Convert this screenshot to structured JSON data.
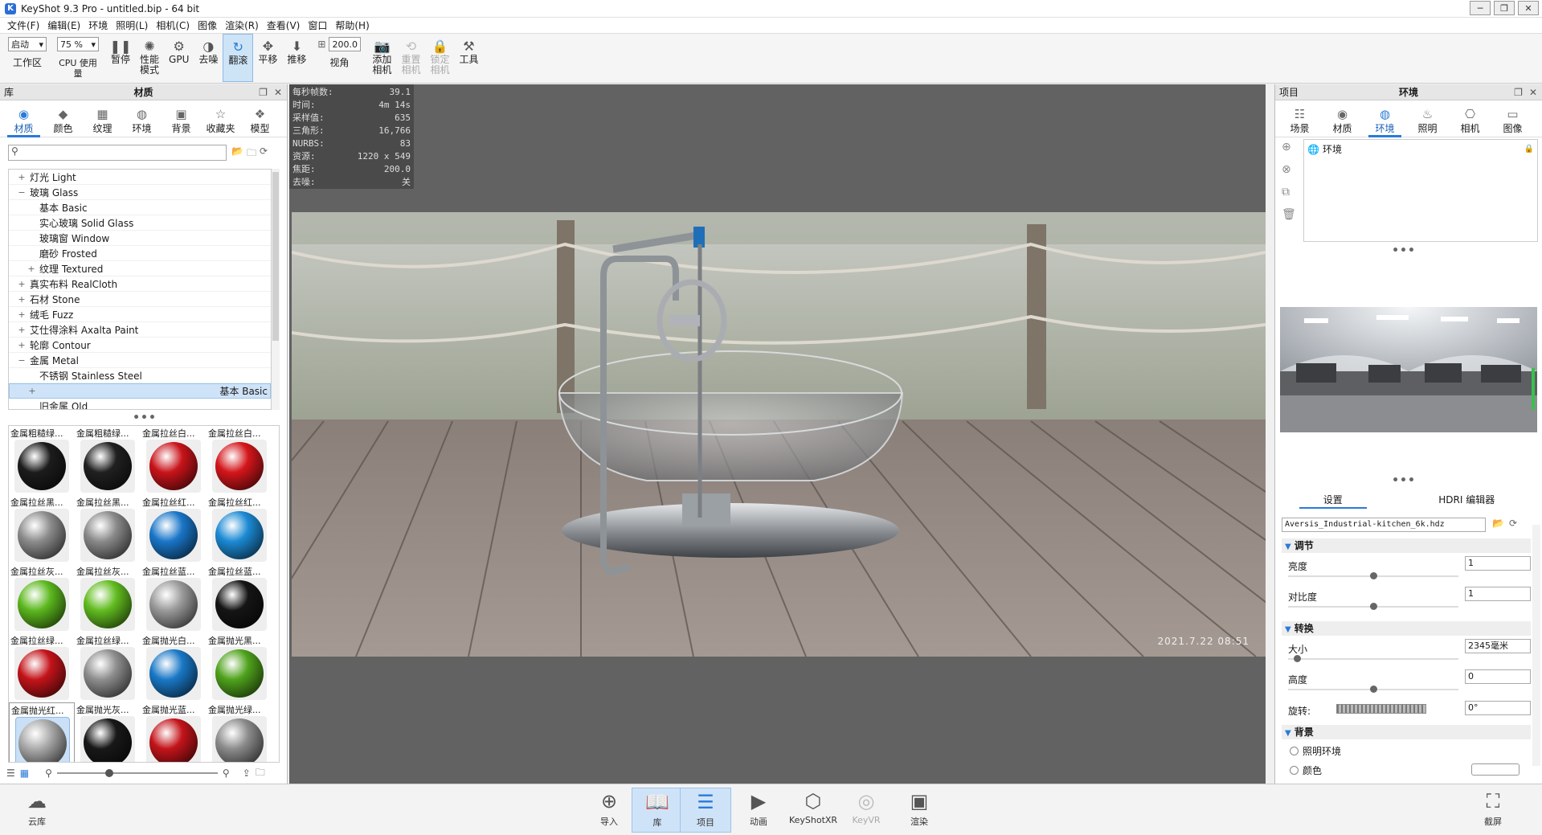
{
  "window": {
    "title": "KeyShot 9.3 Pro  - untitled.bip  - 64 bit"
  },
  "menu": [
    "文件(F)",
    "编辑(E)",
    "环境",
    "照明(L)",
    "相机(C)",
    "图像",
    "渲染(R)",
    "查看(V)",
    "窗口",
    "帮助(H)"
  ],
  "toolbar": {
    "workspace_select": "启动",
    "workspace_label": "工作区",
    "cpu_select": "75 %",
    "cpu_label": "CPU 使用量",
    "pause_label": "暂停",
    "perf_label": "性能\n模式",
    "gpu_label": "GPU",
    "denoise_label": "去噪",
    "tumble_label": "翻滚",
    "pan_label": "平移",
    "dolly_label": "推移",
    "fov_value": "200.0",
    "fov_label": "视角",
    "add_camera_label": "添加\n相机",
    "reset_camera_label": "重置\n相机",
    "lock_camera_label": "锁定\n相机",
    "tools_label": "工具"
  },
  "left_panel": {
    "header_left": "库",
    "header_title": "材质",
    "tabs": [
      {
        "label": "材质",
        "icon": "material-icon",
        "active": true
      },
      {
        "label": "颜色",
        "icon": "color-icon",
        "active": false
      },
      {
        "label": "纹理",
        "icon": "texture-icon",
        "active": false
      },
      {
        "label": "环境",
        "icon": "environment-icon",
        "active": false
      },
      {
        "label": "背景",
        "icon": "background-icon",
        "active": false
      },
      {
        "label": "收藏夹",
        "icon": "favorites-icon",
        "active": false
      },
      {
        "label": "模型",
        "icon": "model-icon",
        "active": false
      }
    ],
    "tree": [
      {
        "label": "灯光 Light",
        "indent": 1,
        "exp": "+",
        "selected": false
      },
      {
        "label": "玻璃 Glass",
        "indent": 1,
        "exp": "−",
        "selected": false
      },
      {
        "label": "基本 Basic",
        "indent": 2,
        "exp": "",
        "selected": false
      },
      {
        "label": "实心玻璃 Solid Glass",
        "indent": 2,
        "exp": "",
        "selected": false
      },
      {
        "label": "玻璃窗 Window",
        "indent": 2,
        "exp": "",
        "selected": false
      },
      {
        "label": "磨砂 Frosted",
        "indent": 2,
        "exp": "",
        "selected": false
      },
      {
        "label": "纹理 Textured",
        "indent": 2,
        "exp": "+",
        "selected": false
      },
      {
        "label": "真实布料 RealCloth",
        "indent": 1,
        "exp": "+",
        "selected": false
      },
      {
        "label": "石材 Stone",
        "indent": 1,
        "exp": "+",
        "selected": false
      },
      {
        "label": "绒毛 Fuzz",
        "indent": 1,
        "exp": "+",
        "selected": false
      },
      {
        "label": "艾仕得涂料 Axalta Paint",
        "indent": 1,
        "exp": "+",
        "selected": false
      },
      {
        "label": "轮廓 Contour",
        "indent": 1,
        "exp": "+",
        "selected": false
      },
      {
        "label": "金属 Metal",
        "indent": 1,
        "exp": "−",
        "selected": false
      },
      {
        "label": "不锈钢 Stainless Steel",
        "indent": 2,
        "exp": "",
        "selected": false
      },
      {
        "label": "基本 Basic",
        "indent": 2,
        "exp": "+",
        "selected": true
      },
      {
        "label": "旧金属 Old",
        "indent": 2,
        "exp": "",
        "selected": false
      }
    ],
    "materials": [
      {
        "name": "金属粗糙绿...",
        "color": "#1c1c1c"
      },
      {
        "name": "金属粗糙绿...",
        "color": "#202020"
      },
      {
        "name": "金属拉丝白...",
        "color": "#c8141a"
      },
      {
        "name": "金属拉丝白...",
        "color": "#d4161b"
      },
      {
        "name": "金属拉丝黑...",
        "color": "#8c8c8c"
      },
      {
        "name": "金属拉丝黑...",
        "color": "#8a8a8a"
      },
      {
        "name": "金属拉丝红...",
        "color": "#1a76c8"
      },
      {
        "name": "金属拉丝红...",
        "color": "#1c8ad4"
      },
      {
        "name": "金属拉丝灰...",
        "color": "#5cb81e"
      },
      {
        "name": "金属拉丝灰...",
        "color": "#62bc20"
      },
      {
        "name": "金属拉丝蓝...",
        "color": "#9a9a9a"
      },
      {
        "name": "金属拉丝蓝...",
        "color": "#151515"
      },
      {
        "name": "金属拉丝绿...",
        "color": "#c3141a"
      },
      {
        "name": "金属拉丝绿...",
        "color": "#8e8e8e"
      },
      {
        "name": "金属抛光白...",
        "color": "#1a78c6"
      },
      {
        "name": "金属抛光黑...",
        "color": "#4fa21c"
      },
      {
        "name": "金属抛光红...",
        "color": "#a8a8a8"
      },
      {
        "name": "金属抛光灰...",
        "color": "#181818"
      },
      {
        "name": "金属抛光蓝...",
        "color": "#c3141a"
      },
      {
        "name": "金属抛光绿...",
        "color": "#8c8c8c"
      }
    ]
  },
  "viewport": {
    "stats": [
      {
        "k": "每秒帧数:",
        "v": "39.1"
      },
      {
        "k": "时间:",
        "v": "4m 14s"
      },
      {
        "k": "采样值:",
        "v": "635"
      },
      {
        "k": "三角形:",
        "v": "16,766"
      },
      {
        "k": "NURBS:",
        "v": "83"
      },
      {
        "k": "资源:",
        "v": "1220 x 549"
      },
      {
        "k": "焦距:",
        "v": "200.0"
      },
      {
        "k": "去噪:",
        "v": "关"
      }
    ],
    "timestamp": "2021.7.22 08:51"
  },
  "right_panel": {
    "header_left": "项目",
    "header_title": "环境",
    "tabs": [
      {
        "label": "场景",
        "icon": "scene-icon",
        "active": false
      },
      {
        "label": "材质",
        "icon": "material-icon",
        "active": false
      },
      {
        "label": "环境",
        "icon": "environment-icon",
        "active": true
      },
      {
        "label": "照明",
        "icon": "lighting-icon",
        "active": false
      },
      {
        "label": "相机",
        "icon": "camera-icon",
        "active": false
      },
      {
        "label": "图像",
        "icon": "image-icon",
        "active": false
      }
    ],
    "env_item": "环境",
    "subtabs": [
      "设置",
      "HDRI 编辑器"
    ],
    "hdri_file": "Aversis_Industrial-kitchen_6k.hdz",
    "sections": {
      "adjust": "调节",
      "transform": "转换",
      "background": "背景"
    },
    "brightness": {
      "label": "亮度",
      "value": "1",
      "level": 0.5
    },
    "contrast": {
      "label": "对比度",
      "value": "1",
      "level": 0.5
    },
    "size": {
      "label": "大小",
      "value": "2345毫米",
      "level": 0.05
    },
    "height": {
      "label": "高度",
      "value": "0",
      "level": 0.5
    },
    "rotation": {
      "label": "旋转:",
      "value": "0°"
    },
    "bg_options": [
      "照明环境",
      "颜色"
    ]
  },
  "bottom": [
    {
      "label": "云库",
      "icon": "cloud-library-icon",
      "active": false,
      "dim": false
    },
    {
      "label": "导入",
      "icon": "import-icon",
      "active": false,
      "dim": false
    },
    {
      "label": "库",
      "icon": "library-icon",
      "active": true,
      "dim": false
    },
    {
      "label": "项目",
      "icon": "project-icon",
      "active": true,
      "dim": false
    },
    {
      "label": "动画",
      "icon": "animation-icon",
      "active": false,
      "dim": false
    },
    {
      "label": "KeyShotXR",
      "icon": "keyshotxr-icon",
      "active": false,
      "dim": false
    },
    {
      "label": "KeyVR",
      "icon": "keyvr-icon",
      "active": false,
      "dim": true
    },
    {
      "label": "渲染",
      "icon": "render-icon",
      "active": false,
      "dim": false
    },
    {
      "label": "截屏",
      "icon": "screenshot-icon",
      "active": false,
      "dim": false
    }
  ]
}
